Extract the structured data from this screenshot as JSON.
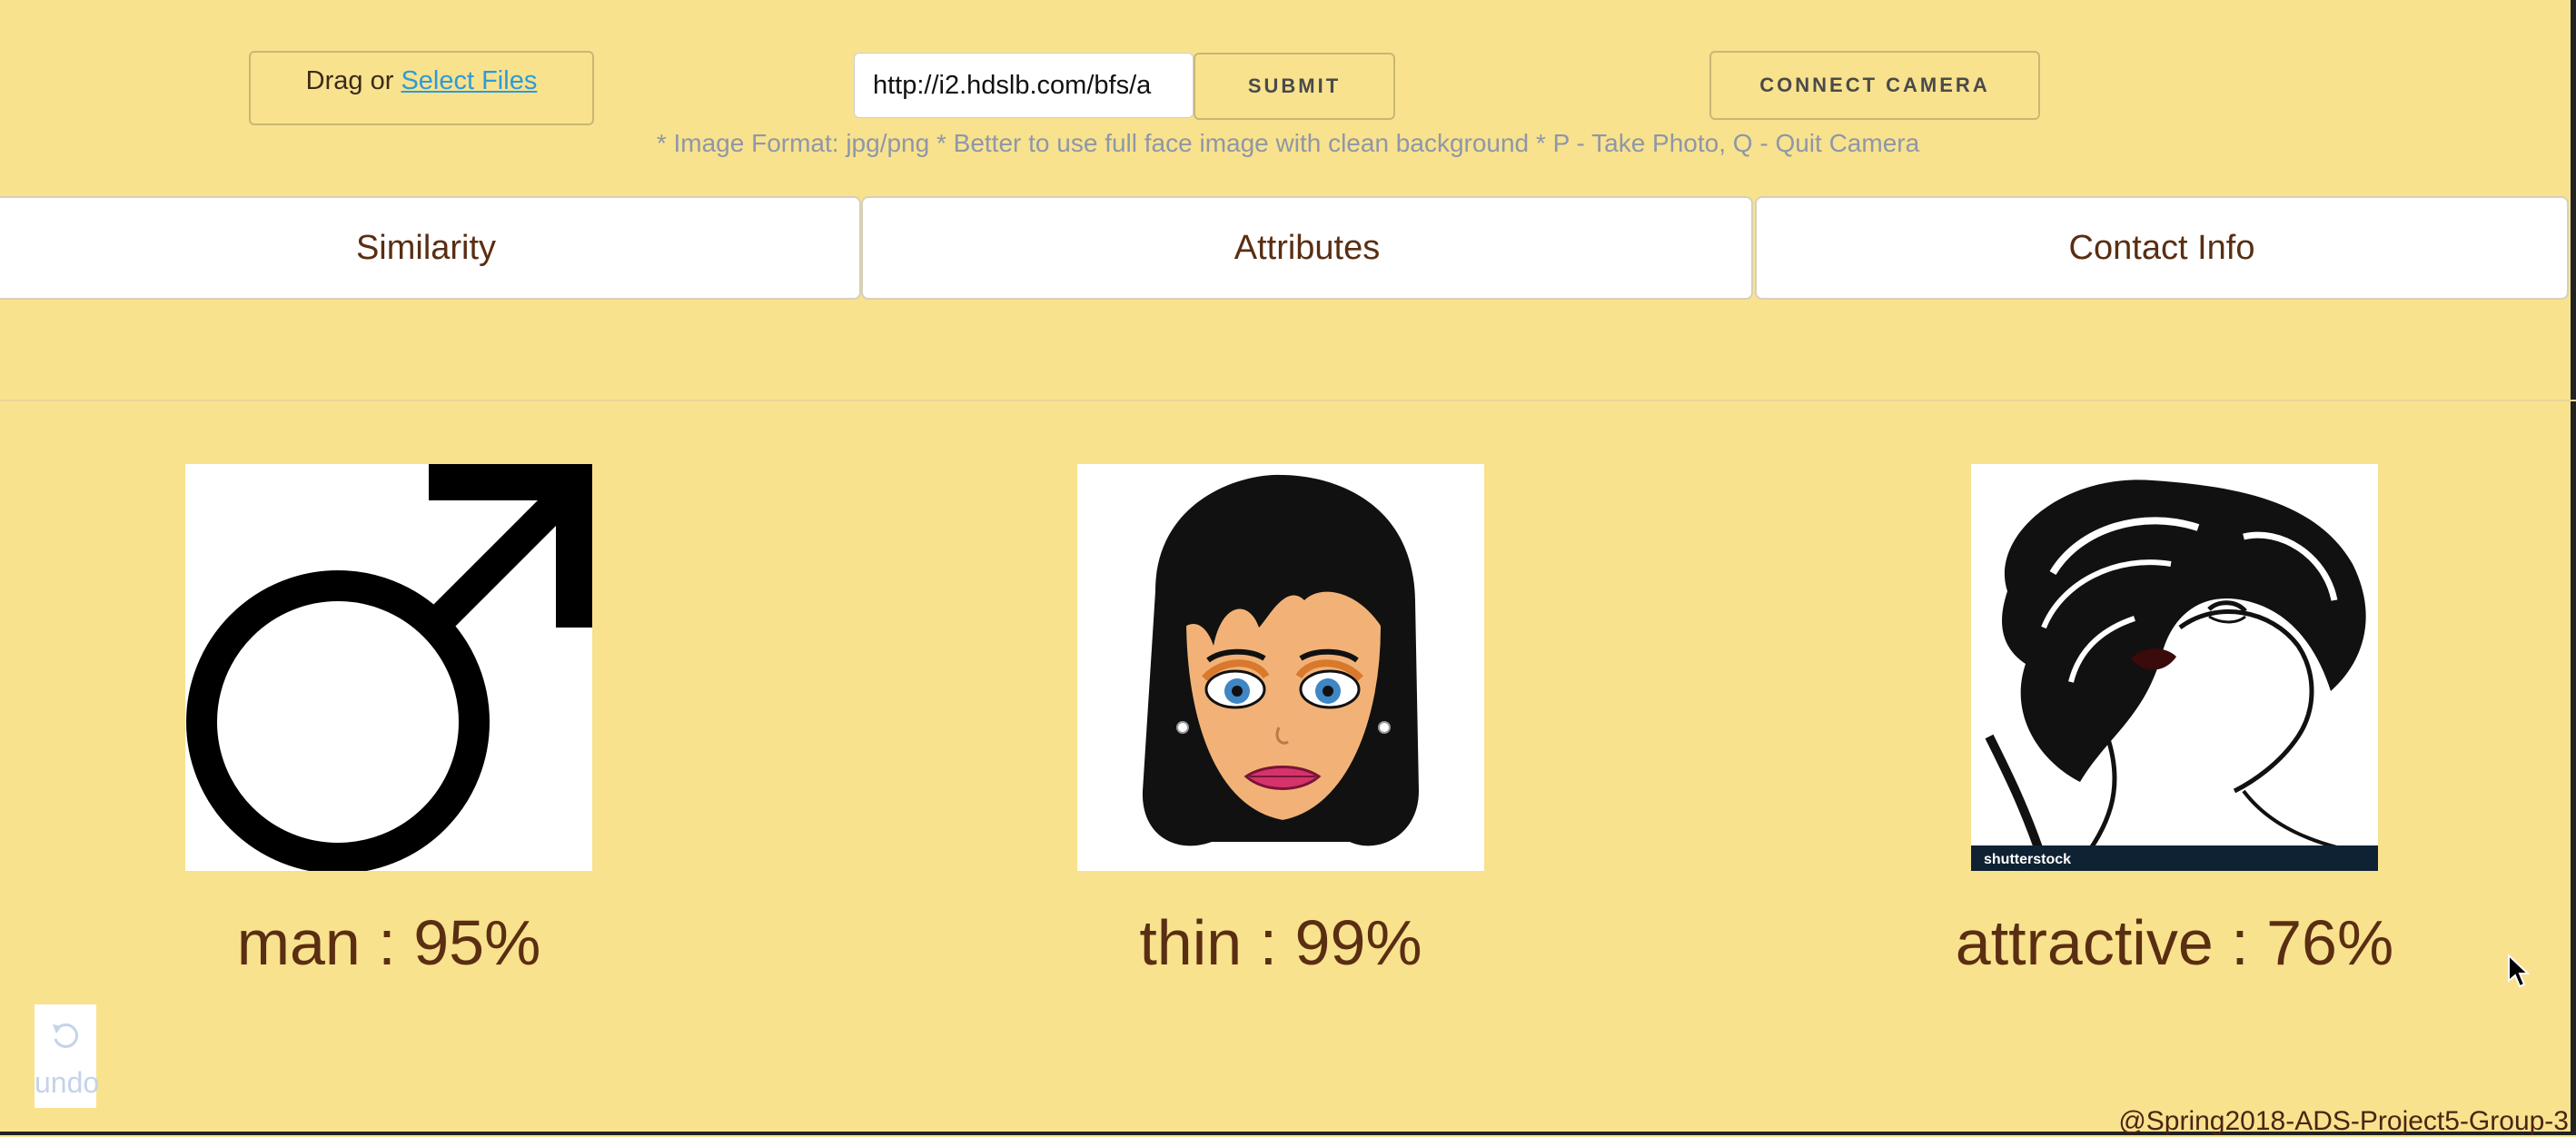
{
  "upload": {
    "drag_text": "Drag or",
    "select_files_link": "Select Files"
  },
  "url_input": {
    "value": "http://i2.hdslb.com/bfs/a"
  },
  "buttons": {
    "submit": "SUBMIT",
    "connect_camera": "CONNECT CAMERA"
  },
  "hint": "* Image Format: jpg/png * Better to use full face image with clean background * P - Take Photo, Q - Quit Camera",
  "tabs": [
    {
      "label": "Similarity"
    },
    {
      "label": "Attributes"
    },
    {
      "label": "Contact Info"
    }
  ],
  "results": [
    {
      "label": "man : 95%",
      "icon": "male-symbol-icon"
    },
    {
      "label": "thin : 99%",
      "icon": "cartoon-woman-face-icon"
    },
    {
      "label": "attractive : 76%",
      "icon": "illustrated-woman-portrait-icon",
      "watermark": "shutterstock"
    }
  ],
  "undo": {
    "label": "undo",
    "icon": "undo-icon"
  },
  "footer": "@Spring2018-ADS-Project5-Group-3",
  "colors": {
    "background": "#F8E28E",
    "text_brown": "#5a2e12",
    "link_blue": "#2e9bd6",
    "hint_gray": "#8e97a8"
  }
}
